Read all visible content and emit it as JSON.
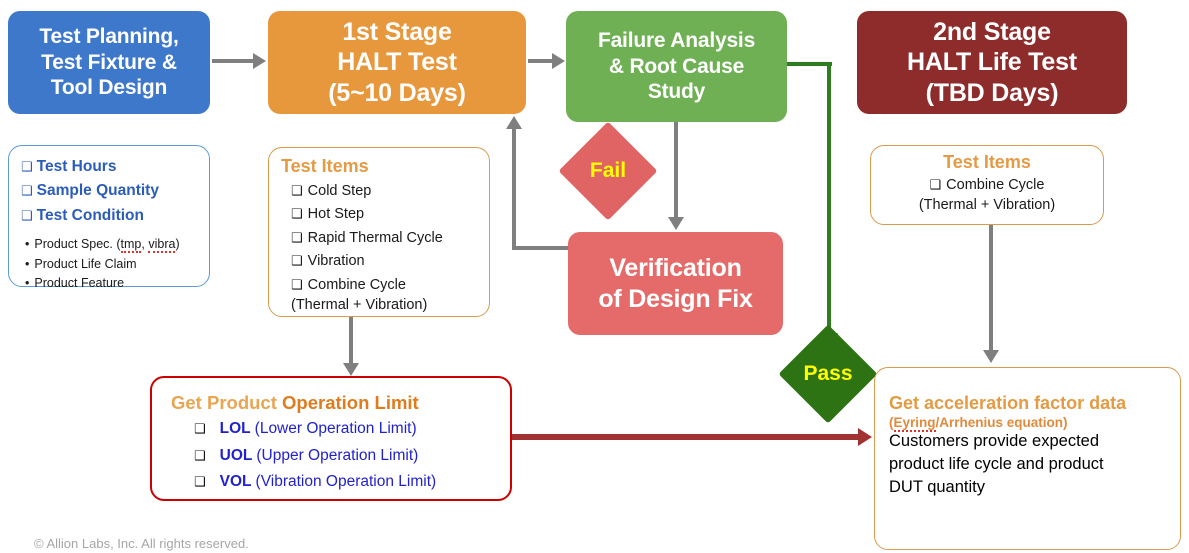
{
  "nodes": {
    "planning": {
      "lines": [
        "Test Planning,",
        "Test Fixture &",
        "Tool Design"
      ],
      "color": "#3D78CB"
    },
    "halt1": {
      "lines": [
        "1st Stage",
        "HALT Test",
        "(5~10 Days)"
      ],
      "color": "#E8983C"
    },
    "failure": {
      "lines": [
        "Failure Analysis",
        "& Root Cause",
        "Study"
      ],
      "color": "#6FB055"
    },
    "halt2": {
      "lines": [
        "2nd Stage",
        "HALT Life Test",
        "(TBD Days)"
      ],
      "color": "#8E2C2C"
    },
    "verify": {
      "lines": [
        "Verification",
        "of Design Fix"
      ],
      "color": "#E56B6B"
    }
  },
  "decisions": {
    "fail": {
      "label": "Fail",
      "fill": "#E06464",
      "text_color": "#FFFF00"
    },
    "pass": {
      "label": "Pass",
      "fill": "#2D7314",
      "text_color": "#FFFF00"
    }
  },
  "test_condition": {
    "checks": [
      "Test Hours",
      "Sample Quantity",
      "Test Condition"
    ],
    "bullets_pre": [
      "Product Spec. (",
      "Product Life Claim",
      "Product Feature"
    ],
    "bullet1_parts": {
      "lead": "Product Spec. (",
      "sp1": "tmp",
      "mid": ", ",
      "sp2": "vibra",
      "tail": ")"
    },
    "bullet2": "Product Life Claim",
    "bullet3": "Product Feature",
    "border_color": "#5B9BD5",
    "text_color": "#2B5CB8"
  },
  "test_items_left": {
    "title": "Test Items",
    "checks": [
      "Cold Step",
      "Hot Step",
      "Rapid Thermal Cycle",
      "Vibration",
      "Combine Cycle"
    ],
    "subline": "(Thermal + Vibration)",
    "border_color": "#D99A4E",
    "title_color": "#E59A44"
  },
  "test_items_right": {
    "title": "Test Items",
    "check": "Combine Cycle",
    "subline": "(Thermal + Vibration)",
    "border_color": "#D99A4E",
    "title_color": "#E59A44"
  },
  "operation_limit": {
    "title_part1": "Get Product ",
    "title_part2": "Operation Limit",
    "items": [
      {
        "abbr": "LOL",
        "desc": "(Lower Operation Limit)"
      },
      {
        "abbr": "UOL",
        "desc": "(Upper Operation Limit)"
      },
      {
        "abbr": "VOL",
        "desc": "(Vibration Operation Limit)"
      }
    ],
    "border_color": "#CC0000",
    "abbr_color": "#2222CC"
  },
  "acceleration": {
    "title": "Get acceleration factor data",
    "subtitle_sp": "Eyring",
    "subtitle_rest": "/Arrhenius equation)",
    "subtitle_open": "(",
    "body_lines": [
      "Customers provide expected",
      "product life cycle and product",
      "DUT quantity"
    ],
    "border_color": "#D99A4E",
    "title_color": "#E59A44"
  },
  "icons": {
    "checkbox": "❑"
  },
  "footer": {
    "text": "© Allion Labs, Inc. All rights reserved.",
    "color": "#A6A6A6"
  },
  "connector_colors": {
    "gray": "#7F7F7F",
    "green": "#2E7D1E",
    "dark_red": "#A03232"
  }
}
